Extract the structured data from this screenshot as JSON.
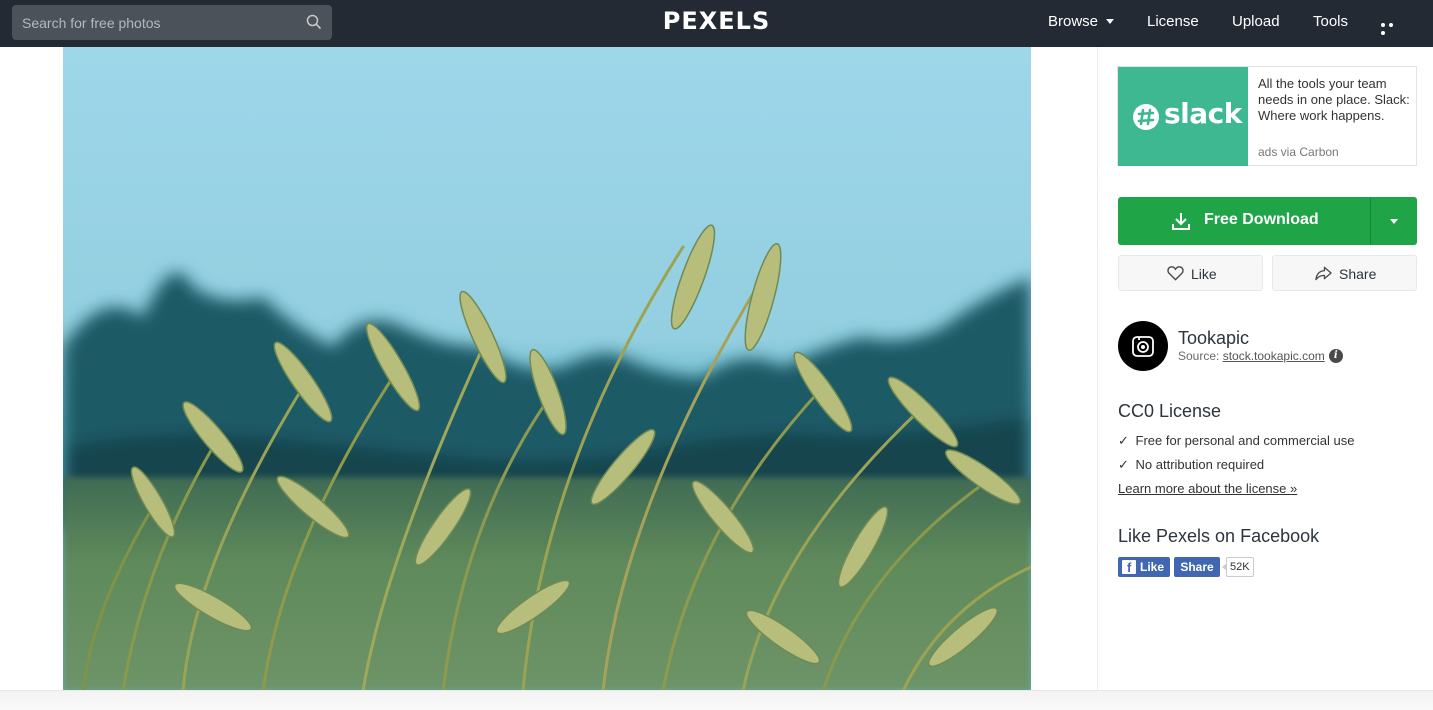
{
  "header": {
    "search": {
      "placeholder": "Search for free photos",
      "icon": "search-icon"
    },
    "logo": "PEXELS",
    "nav": [
      {
        "label": "Browse"
      },
      {
        "label": "License"
      },
      {
        "label": "Upload"
      },
      {
        "label": "Tools"
      }
    ],
    "more_icon": "more-dots-icon"
  },
  "photo": {
    "subject": "",
    "colors": {
      "sky": "#9cd4e6",
      "trees": "#1d5560",
      "field": "#6a8f5a"
    }
  },
  "ad": {
    "brand": "slack",
    "text": "All the tools your team needs in one place. Slack: Where work happens.",
    "via": "ads via Carbon",
    "bg_color": "#3eb890"
  },
  "download": {
    "label": "Free Download",
    "icon": "download-icon",
    "color": "#1fa448"
  },
  "actions": {
    "like_label": "Like",
    "share_label": "Share"
  },
  "author": {
    "name": "Tookapic",
    "source_prefix": "Source:",
    "source_link": "stock.tookapic.com",
    "info": "i"
  },
  "license": {
    "title": "CC0 License",
    "items": [
      {
        "check": "✓",
        "text": "Free for personal and commercial use"
      },
      {
        "check": "✓",
        "text": "No attribution required"
      }
    ],
    "link": "Learn more about the license »"
  },
  "facebook": {
    "title": "Like Pexels on Facebook",
    "like_label": "Like",
    "f": "f",
    "share_label": "Share",
    "count": "52K",
    "color": "#4267b2"
  }
}
